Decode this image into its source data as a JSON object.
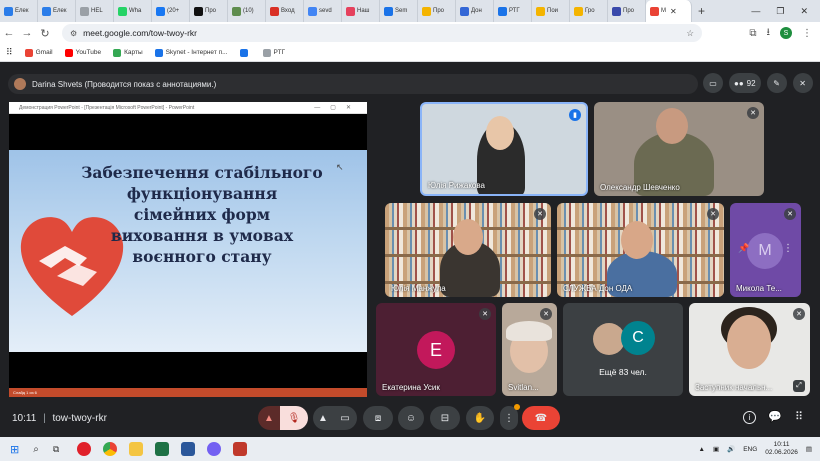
{
  "browser": {
    "tabs": [
      {
        "label": "Елек",
        "color": "#2b7de9"
      },
      {
        "label": "Елек",
        "color": "#2b7de9"
      },
      {
        "label": "HEL",
        "color": "#9aa0a6"
      },
      {
        "label": "Wha",
        "color": "#25d366"
      },
      {
        "label": "(20+",
        "color": "#1877f2"
      },
      {
        "label": "Про",
        "color": "#111111"
      },
      {
        "label": "(10)",
        "color": "#5f8d4e"
      },
      {
        "label": "Вход",
        "color": "#d93025"
      },
      {
        "label": "sevd",
        "color": "#4285f4"
      },
      {
        "label": "Наш",
        "color": "#e5415d"
      },
      {
        "label": "Sem",
        "color": "#1a73e8"
      },
      {
        "label": "Про",
        "color": "#f4b400"
      },
      {
        "label": "Дон",
        "color": "#3367d6"
      },
      {
        "label": "РТГ",
        "color": "#1a73e8"
      },
      {
        "label": "Пои",
        "color": "#f4b400"
      },
      {
        "label": "Гро",
        "color": "#f4b400"
      },
      {
        "label": "Про",
        "color": "#3949ab"
      }
    ],
    "active_tab": {
      "label": "M",
      "color": "#ea4335"
    },
    "new_tab": "+",
    "window_controls": [
      "—",
      "❐",
      "✕"
    ],
    "url": "meet.google.com/tow-twoy-rkr",
    "profile_letter": "S",
    "bookmarks": [
      {
        "label": "Gmail",
        "color": "#ea4335"
      },
      {
        "label": "YouTube",
        "color": "#ff0000"
      },
      {
        "label": "Карты",
        "color": "#34a853"
      },
      {
        "label": "Skynet - Інтернет п...",
        "color": "#1a73e8"
      },
      {
        "label": "",
        "color": "#1a73e8"
      },
      {
        "label": "РТГ",
        "color": "#9aa0a6"
      }
    ]
  },
  "meet": {
    "presenter_text": "Darina Shvets (Проводится показ с аннотациями.)",
    "participant_count": "92",
    "presentation": {
      "window_title": "Демонстрация PowerPoint - [Презентація Microsoft PowerPoint] - PowerPoint",
      "slide_lines": [
        "Забезпечення стабільного",
        "функціонування",
        "сімейних форм",
        "виховання в умовах",
        "воєнного стану"
      ],
      "status": "Слайд 1 из 6"
    },
    "tiles": [
      {
        "name": "Юлія Рижакова"
      },
      {
        "name": "Олександр Шевченко"
      },
      {
        "name": "Юлія Манжула"
      },
      {
        "name": "СЛУЖБА Дон ОДА"
      },
      {
        "name": "Микола Те...",
        "initial": "М"
      },
      {
        "name": "Екатерина Усик",
        "initial": "E"
      },
      {
        "name": "Svitlan..."
      },
      {
        "name": "Ещё 83 чел.",
        "initial": "C"
      },
      {
        "name": "Заступник начальн..."
      }
    ],
    "meeting_code": "tow-twoy-rkr",
    "time": "10:11"
  },
  "taskbar": {
    "language": "ENG",
    "time": "10:11",
    "date": "02.06.2026"
  },
  "colors": {
    "meet_bg": "#202124",
    "leave_red": "#ea4335",
    "avatar_e": "#c2185b",
    "avatar_c": "#00838f",
    "avatar_m": "#5e35b1"
  }
}
